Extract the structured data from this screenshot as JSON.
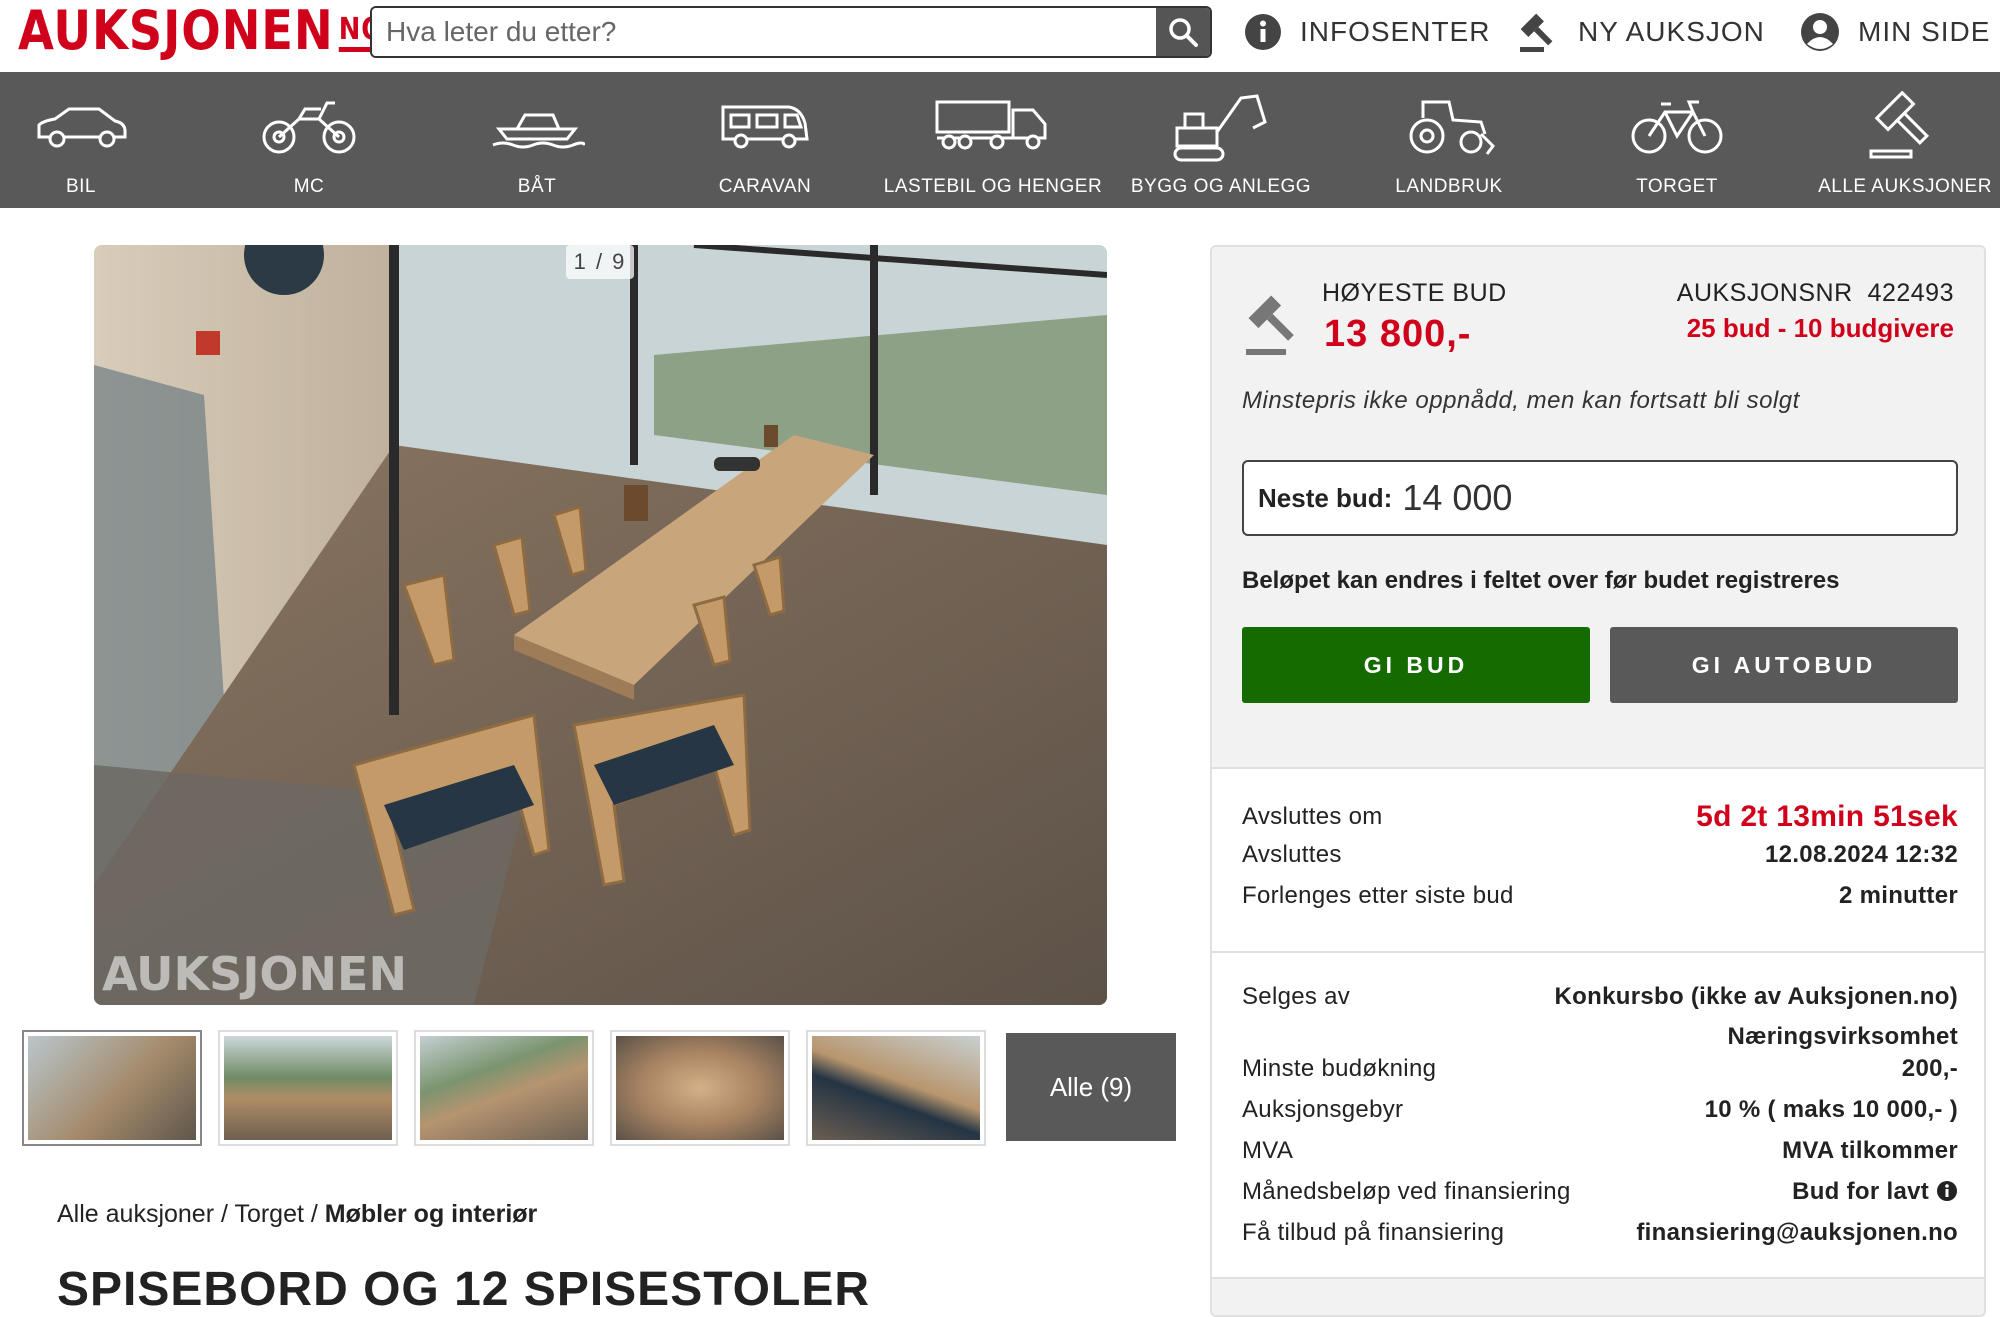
{
  "header": {
    "logo_text": "AUKSJONEN",
    "logo_suffix": "NO",
    "search_placeholder": "Hva leter du etter?",
    "links": [
      {
        "label": "INFOSENTER",
        "icon": "info-circle-icon"
      },
      {
        "label": "NY AUKSJON",
        "icon": "gavel-icon"
      },
      {
        "label": "MIN SIDE",
        "icon": "user-circle-icon"
      }
    ]
  },
  "categories": [
    {
      "label": "BIL",
      "icon": "car-icon"
    },
    {
      "label": "MC",
      "icon": "motorcycle-icon"
    },
    {
      "label": "BÅT",
      "icon": "boat-icon"
    },
    {
      "label": "CARAVAN",
      "icon": "caravan-icon"
    },
    {
      "label": "LASTEBIL OG HENGER",
      "icon": "truck-icon"
    },
    {
      "label": "BYGG OG ANLEGG",
      "icon": "excavator-icon"
    },
    {
      "label": "LANDBRUK",
      "icon": "tractor-icon"
    },
    {
      "label": "TORGET",
      "icon": "bicycle-icon"
    },
    {
      "label": "ALLE AUKSJONER",
      "icon": "gavel-icon"
    }
  ],
  "gallery": {
    "counter": "1 / 9",
    "watermark": "AUKSJONEN",
    "all_button": "Alle (9)",
    "thumbnails": 5
  },
  "breadcrumb": {
    "items": [
      "Alle auksjoner",
      "Torget"
    ],
    "separator": "/",
    "current": "Møbler og interiør"
  },
  "listing_title": "SPISEBORD OG 12 SPISESTOLER",
  "bid": {
    "highest_label": "HØYESTE BUD",
    "highest_value": "13 800,-",
    "auction_nr_label": "AUKSJONSNR",
    "auction_nr": "422493",
    "bid_count": "25 bud - 10 budgivere",
    "reserve_note": "Minstepris ikke oppnådd, men kan fortsatt bli solgt",
    "next_bid_label": "Neste bud:",
    "next_bid_value": "14 000",
    "amount_note": "Beløpet kan endres i feltet over før budet registreres",
    "bid_button": "GI BUD",
    "autobid_button": "GI AUTOBUD"
  },
  "timing": [
    {
      "label": "Avsluttes om",
      "value": "5d 2t 13min 51sek"
    },
    {
      "label": "Avsluttes",
      "value": "12.08.2024 12:32"
    },
    {
      "label": "Forlenges etter siste bud",
      "value": "2 minutter"
    }
  ],
  "details": {
    "seller_label": "Selges av",
    "seller_value": "Konkursbo (ikke av Auksjonen.no)",
    "seller_type": "Næringsvirksomhet",
    "rows": [
      {
        "label": "Minste budøkning",
        "value": "200,-"
      },
      {
        "label": "Auksjonsgebyr",
        "value": "10 % ( maks 10 000,- )"
      },
      {
        "label": "MVA",
        "value": "MVA tilkommer"
      },
      {
        "label": "Månedsbeløp ved finansiering",
        "value": "Bud for lavt"
      },
      {
        "label": "Få tilbud på finansiering",
        "value": "finansiering@auksjonen.no"
      }
    ]
  },
  "colors": {
    "brand_red": "#d0021b",
    "nav_gray": "#595959",
    "bid_green": "#156a00"
  }
}
